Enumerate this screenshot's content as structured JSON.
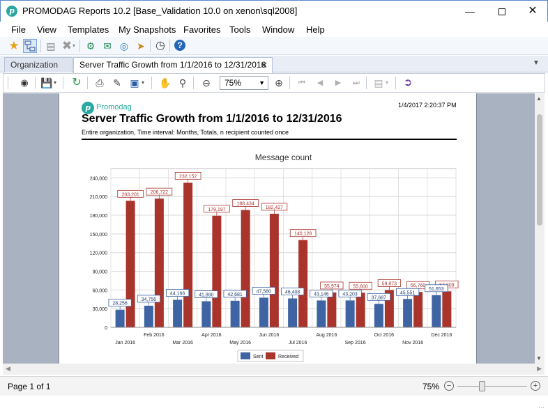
{
  "window": {
    "title": "PROMODAG Reports 10.2 [Base_Validation 10.0 on xenon\\sql2008]",
    "app_icon_letter": "p"
  },
  "menu": [
    "File",
    "View",
    "Templates",
    "My Snapshots",
    "Favorites",
    "Tools",
    "Window",
    "Help"
  ],
  "tabs": {
    "inactive": "Organization",
    "active": "Server Traffic Growth from 1/1/2016 to 12/31/2016"
  },
  "viewer_toolbar": {
    "zoom": "75%"
  },
  "report": {
    "brand": "Promodag",
    "date": "1/4/2017 2:20:37 PM",
    "title": "Server Traffic Growth from 1/1/2016 to 12/31/2016",
    "subtitle": "Entire organization, Time interval: Months, Totals, n recipient counted once"
  },
  "chart_data": {
    "type": "bar",
    "title": "Message count",
    "categories": [
      "Jan 2016",
      "Feb 2016",
      "Mar 2016",
      "Apr 2016",
      "May 2016",
      "Jun 2016",
      "Jul 2016",
      "Aug 2016",
      "Sep 2016",
      "Oct 2016",
      "Nov 2016",
      "Dec 2016"
    ],
    "series": [
      {
        "name": "Sent",
        "color": "#3e64a3",
        "values": [
          28256,
          34756,
          44166,
          41890,
          42681,
          47580,
          46408,
          43146,
          43203,
          37687,
          45551,
          51653
        ]
      },
      {
        "name": "Received",
        "color": "#a8342c",
        "values": [
          203201,
          206722,
          232152,
          179197,
          188434,
          182427,
          140128,
          55974,
          55600,
          59873,
          56760,
          57809
        ]
      }
    ],
    "value_labels": {
      "Sent": [
        "28,256",
        "34,756",
        "44,166",
        "41,890",
        "42,681",
        "47,580",
        "46,408",
        "43,146",
        "43,203",
        "37,687",
        "45,551",
        "51,653"
      ],
      "Received": [
        "203,201",
        "206,722",
        "232,152",
        "179,197",
        "188,434",
        "182,427",
        "140,128",
        "55,974",
        "55,600",
        "59,873",
        "56,760",
        "57,809"
      ]
    },
    "yticks": [
      "0",
      "30,000",
      "60,000",
      "90,000",
      "120,000",
      "150,000",
      "180,000",
      "210,000",
      "240,000"
    ],
    "ylim": [
      0,
      255000
    ],
    "grid": true,
    "legend_position": "bottom-center"
  },
  "status": {
    "page": "Page 1 of 1",
    "zoom": "75%",
    "zoom_level_fraction": 0.36
  }
}
